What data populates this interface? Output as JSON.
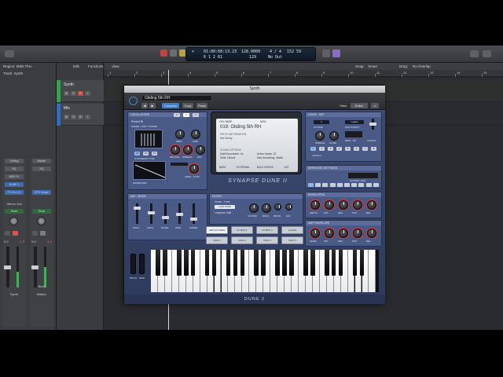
{
  "control_bar": {
    "lcd_time": "01:00:08:13.23",
    "lcd_bars": "6  1  2  81",
    "lcd_tempo": "128.0000",
    "lcd_tempo_2": "129",
    "lcd_sig": "4 / 4",
    "lcd_sig_2": "No Out",
    "lcd_keys": "C maj",
    "lcd_cpu": "152",
    "lcd_cpu_2": "59"
  },
  "inspector": {
    "region": "Region: MIDI Thru",
    "track": "Track: Synth",
    "strip1": {
      "slot_a": "Setting",
      "slot_b": "EQ",
      "slot_c": "MIDI FX",
      "slot_d": "DUNE 2",
      "slot_e": "FX Pro 2.3",
      "bus": "Stereo Out",
      "mode": "Read",
      "name": "Synth",
      "val_left": "0.0",
      "val_right": "-1.3"
    },
    "strip2": {
      "slot_a": "Master",
      "slot_b": "EQ",
      "slot_c": "VPS Scope",
      "slot_d": "",
      "mode": "Read",
      "name": "Master",
      "val_left": "0.0",
      "val_right": "-1.2",
      "extra": "Bnce"
    }
  },
  "tracks": [
    {
      "name": "Synth",
      "color": "#2fa64a"
    },
    {
      "name": "Mix",
      "color": "#2d6ec7"
    }
  ],
  "toolbar": {
    "edit": "Edit",
    "functions": "Functions",
    "view": "View",
    "snap_label": "Snap:",
    "snap_value": "Smart",
    "drag_label": "Drag:",
    "drag_value": "No Overlap"
  },
  "ruler": [
    "1",
    "2",
    "3",
    "4",
    "5",
    "6",
    "7",
    "8",
    "9",
    "10",
    "11",
    "12",
    "13",
    "14",
    "15"
  ],
  "plugin": {
    "window_title": "Synth",
    "preset": "Gliding 5th RH",
    "compare": "Compare",
    "copy": "Copy",
    "paste": "Paste",
    "view_label": "View:",
    "view_value": "Editor",
    "footer": "DUNE 2",
    "brand": "SYNAPSE DUNE II",
    "screen": {
      "tab1": "OSC BASE",
      "tab2": "MOD",
      "patch": "019: Gliding 5th RH",
      "section1": "PATCH INFORMATION",
      "author": "Hot Cherry",
      "section2": "SOUND OPTIONS",
      "opt1": "Multi/Soundbank: Us",
      "opt2": "Active Voices: 23",
      "opt3": "Glide: Default",
      "opt4": "Mod Smoothing: Stable",
      "bottom1": "BASE",
      "bottom2": "EXTERNAL",
      "bottom3": "BULK MODES",
      "bottom4": "LIST"
    },
    "osc": {
      "title": "OSCILLATORS",
      "type": "Perfect Bl",
      "label1": "SUPER / UNIT / FORMS",
      "knob1": "SEMI",
      "knob2": "FINE",
      "knob3": "DETUNE",
      "knob4": "SPREAD",
      "knob5": "ENV",
      "sync_label": "SYNTHESIS TYPE",
      "btns": [
        "X8",
        "ST",
        "FX"
      ],
      "wave": "WAVEFORM",
      "freq": "FREQ · SYNC"
    },
    "voice": {
      "title": "VOICE · SET",
      "poly": "POLYPHONY",
      "legato": "Legato",
      "octave": "OCTAVE",
      "tones": "VOICE 4",
      "knob1": "SPREAD",
      "knob2": "GLIDE",
      "k1": "GLIDE",
      "k2": "ARP",
      "k3": "VELO",
      "k4": "TUNE",
      "pitch": "PITCH",
      "voices": "VOICES",
      "mode": "MOD · PB",
      "unison": "UNISON",
      "steps": [
        "1",
        "2",
        "3",
        "4",
        "5",
        "6",
        "7",
        "8"
      ],
      "arp_label": "ARPEGGIO SETTINGS",
      "chord": "ACTION / EDIT"
    },
    "mixer": {
      "title": "MIX · MODE",
      "faders": [
        "OSC1",
        "OSC2",
        "NOISE",
        "RING",
        "SUPER"
      ],
      "filter_type": "Lowpass 4dB",
      "mode": "MODE · TYPE",
      "filter_title": "FILTER",
      "fk": [
        "CUTOFF",
        "RESO",
        "DRIVE",
        "KEY"
      ]
    },
    "env": {
      "title": "ENVELOPES",
      "k": [
        "DEPTH",
        "ATK",
        "DEC",
        "SUS",
        "REL"
      ],
      "title2": "AMP ENVELOPE",
      "k2": [
        "LEVEL",
        "ATK",
        "DEC",
        "SUS",
        "REL"
      ]
    },
    "arp_buttons": [
      "ARP PATTERN",
      "FX BUS 1",
      "FX BUS 2",
      "CLEAN",
      "MOD 1",
      "MOD 2",
      "MOD 3",
      "MOD 4"
    ],
    "mod_labels": [
      "PITCH",
      "MOD"
    ]
  }
}
